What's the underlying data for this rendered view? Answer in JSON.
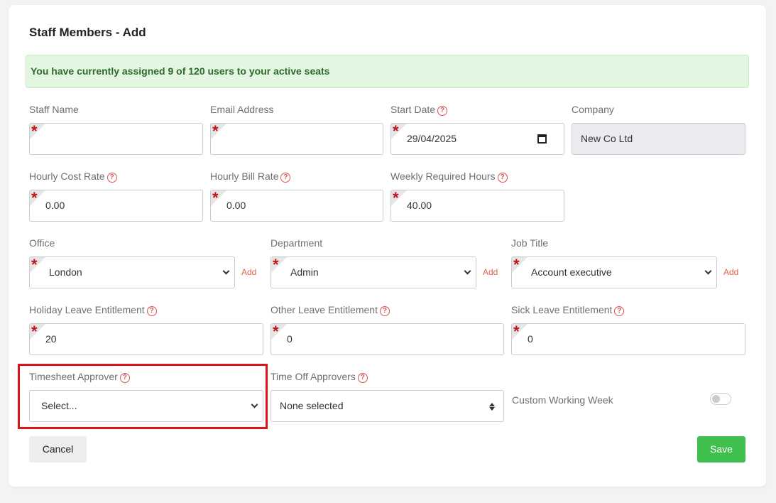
{
  "page": {
    "title": "Staff Members - Add",
    "alert": "You have currently assigned 9 of 120 users to your active seats"
  },
  "fields": {
    "staff_name": {
      "label": "Staff Name",
      "value": ""
    },
    "email": {
      "label": "Email Address",
      "value": ""
    },
    "start_date": {
      "label": "Start Date",
      "value": "29/04/2025"
    },
    "company": {
      "label": "Company",
      "value": "New Co Ltd"
    },
    "hourly_cost": {
      "label": "Hourly Cost Rate",
      "value": "0.00"
    },
    "hourly_bill": {
      "label": "Hourly Bill Rate",
      "value": "0.00"
    },
    "weekly_hours": {
      "label": "Weekly Required Hours",
      "value": "40.00"
    },
    "office": {
      "label": "Office",
      "value": "London",
      "add": "Add"
    },
    "department": {
      "label": "Department",
      "value": "Admin",
      "add": "Add"
    },
    "job_title": {
      "label": "Job Title",
      "value": "Account executive",
      "add": "Add"
    },
    "holiday_leave": {
      "label": "Holiday Leave Entitlement",
      "value": "20"
    },
    "other_leave": {
      "label": "Other Leave Entitlement",
      "value": "0"
    },
    "sick_leave": {
      "label": "Sick Leave Entitlement",
      "value": "0"
    },
    "timesheet_approver": {
      "label": "Timesheet Approver",
      "value": "Select..."
    },
    "time_off_approvers": {
      "label": "Time Off Approvers",
      "value": "None selected"
    },
    "custom_working_week": {
      "label": "Custom Working Week",
      "enabled": false
    }
  },
  "buttons": {
    "cancel": "Cancel",
    "save": "Save"
  },
  "help_glyph": "?",
  "colors": {
    "accent": "#e0624d",
    "success": "#3fbf4e",
    "required": "#c0151a",
    "highlight": "#d9151b"
  }
}
